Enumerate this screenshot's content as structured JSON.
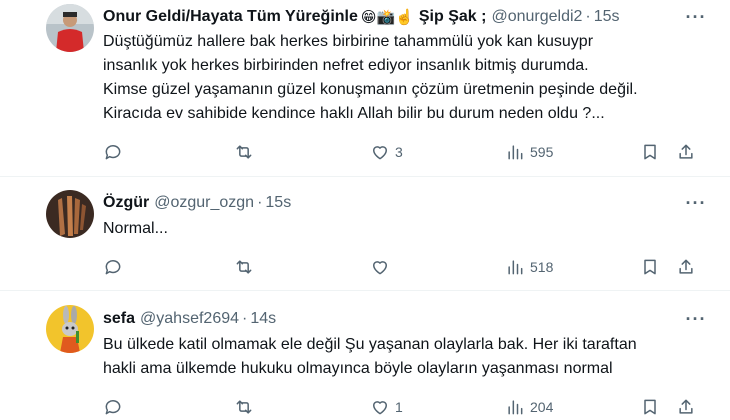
{
  "tweets": [
    {
      "name": "Onur Geldi/Hayata Tüm Yüreğinle",
      "emojis": "😁📸☝️",
      "name_suffix": "Şip Şak ;",
      "handle": "@onurgeldi2",
      "time": "15s",
      "text_lines": [
        "Düştüğümüz hallere bak herkes birbirine tahammülü yok kan kusuypr",
        "insanlık yok herkes birbirinden nefret ediyor insanlık bitmiş durumda.",
        "Kimse güzel yaşamanın güzel konuşmanın çözüm üretmenin peşinde değil.",
        "Kiracıda ev sahibide kendince haklı Allah bilir bu durum neden oldu ?..."
      ],
      "likes": "3",
      "views": "595"
    },
    {
      "name": "Özgür",
      "handle": "@ozgur_ozgn",
      "time": "15s",
      "text_lines": [
        "Normal..."
      ],
      "likes": "",
      "views": "518"
    },
    {
      "name": "sefa",
      "handle": "@yahsef2694",
      "time": "14s",
      "text_lines": [
        "Bu ülkede katil olmamak ele değil Şu yaşanan olaylarla bak. Her iki taraftan",
        "hakli ama ülkemde hukuku olmayınca böyle olayların yaşanması normal"
      ],
      "likes": "1",
      "views": "204"
    }
  ],
  "icons": [
    "reply-icon",
    "retweet-icon",
    "like-icon",
    "views-icon",
    "bookmark-icon",
    "share-icon",
    "more-icon"
  ],
  "colors": {
    "text": "#0f1419",
    "secondary": "#536471",
    "separator": "#eff3f4"
  }
}
